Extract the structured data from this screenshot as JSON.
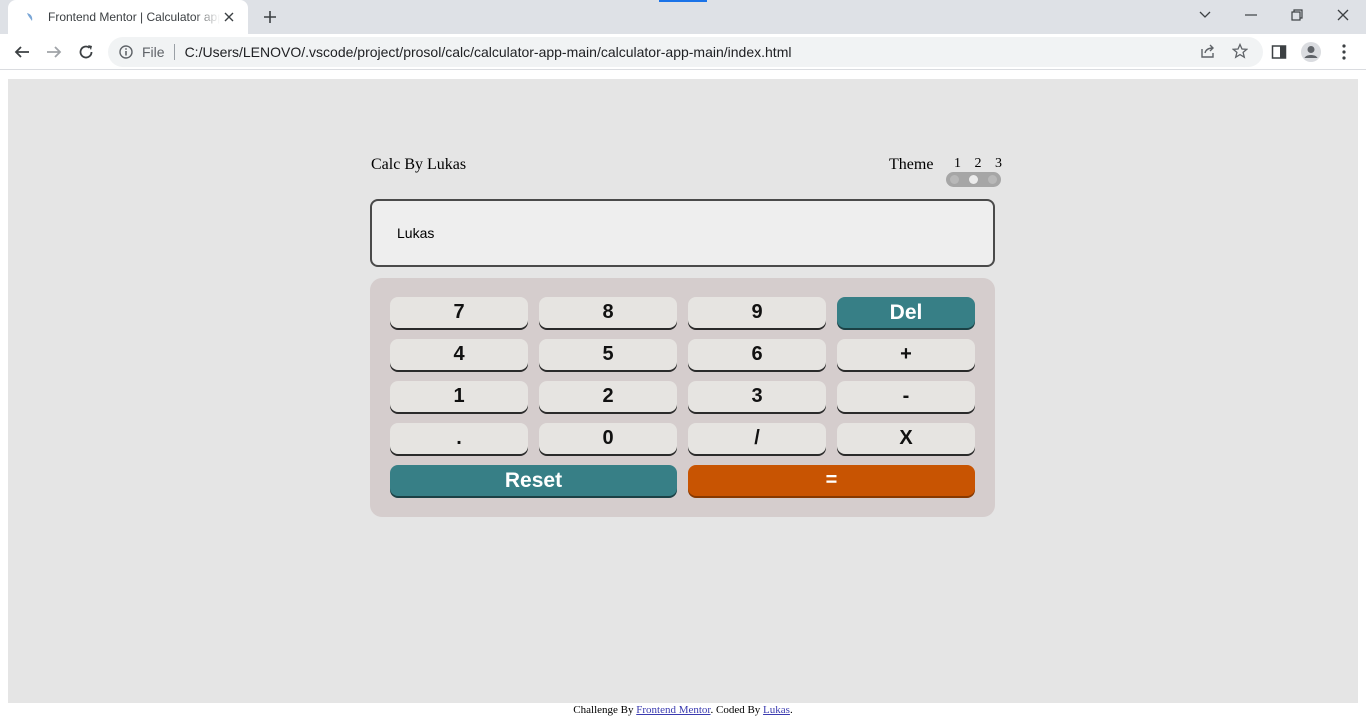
{
  "browser": {
    "tab_title": "Frontend Mentor | Calculator app",
    "address_scheme": "File",
    "address_url": "C:/Users/LENOVO/.vscode/project/prosol/calc/calculator-app-main/calculator-app-main/index.html",
    "icons": [
      "favicon-icon",
      "close-icon",
      "plus-icon",
      "chevron-down-icon",
      "minimize-icon",
      "restore-icon",
      "close-window-icon",
      "back-arrow-icon",
      "forward-arrow-icon",
      "reload-icon",
      "info-icon",
      "share-icon",
      "star-icon",
      "side-panel-icon",
      "profile-icon",
      "menu-icon"
    ]
  },
  "calculator": {
    "title": "Calc By Lukas",
    "theme_label": "Theme",
    "theme_options": [
      "1",
      "2",
      "3"
    ],
    "active_theme": "2",
    "display_value": "Lukas",
    "keys": [
      "7",
      "8",
      "9",
      "Del",
      "4",
      "5",
      "6",
      "+",
      "1",
      "2",
      "3",
      "-",
      ".",
      "0",
      "/",
      "X"
    ],
    "reset_label": "Reset",
    "equals_label": "=",
    "colors": {
      "background": "#e5e5e5",
      "keypad": "#d5cdcd",
      "key": "#e6e4e1",
      "function_key": "#377f86",
      "equals_key": "#c85402",
      "screen": "#eeeeee"
    }
  },
  "footer": {
    "prefix": "Challenge By ",
    "link1": "Frontend Mentor",
    "middle": ". Coded By ",
    "link2": "Lukas",
    "suffix": "."
  }
}
